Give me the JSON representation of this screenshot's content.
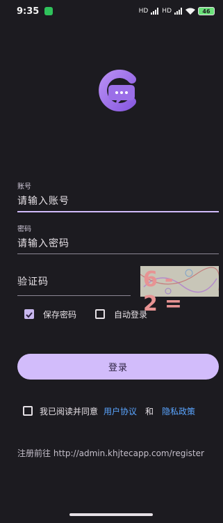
{
  "status_bar": {
    "time": "9:35",
    "network": "HD",
    "battery": "46"
  },
  "app": {
    "logo_icon": "chat-bubble-c-logo"
  },
  "form": {
    "account": {
      "label": "账号",
      "placeholder": "请输入账号"
    },
    "password": {
      "label": "密码",
      "placeholder": "请输入密码"
    },
    "captcha": {
      "placeholder": "验证码",
      "image_text": "6-2="
    },
    "save_password": {
      "label": "保存密码",
      "checked": true
    },
    "auto_login": {
      "label": "自动登录",
      "checked": false
    },
    "login_button": "登录"
  },
  "agreement": {
    "prefix": "我已阅读并同意",
    "user_agreement": "用户协议",
    "and": "和",
    "privacy_policy": "隐私政策",
    "checked": false
  },
  "register": {
    "prefix": "注册前往",
    "url": "http://admin.khjtecapp.com/register"
  },
  "colors": {
    "background": "#1c1b20",
    "accent": "#d2bcfb",
    "link": "#5aa5ff"
  }
}
